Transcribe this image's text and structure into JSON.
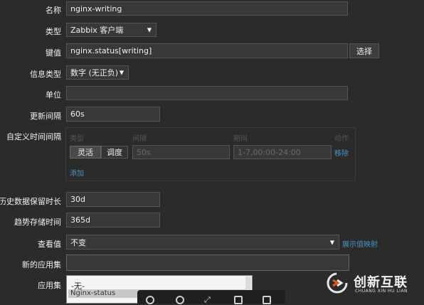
{
  "form": {
    "name_label": "名称",
    "name_value": "nginx-writing",
    "type_label": "类型",
    "type_value": "Zabbix 客户端",
    "key_label": "键值",
    "key_value": "nginx.status[writing]",
    "key_select_button": "选择",
    "info_type_label": "信息类型",
    "info_type_value": "数字 (无正负)",
    "unit_label": "单位",
    "unit_value": "",
    "update_interval_label": "更新间隔",
    "update_interval_value": "60s",
    "custom_intervals_label": "自定义时间间隔",
    "history_label": "历史数据保留时长",
    "history_value": "30d",
    "trends_label": "趋势存储时间",
    "trends_value": "365d",
    "show_value_label": "查看值",
    "show_value_value": "不变",
    "show_value_mapping_link": "展示值映射",
    "new_app_label": "新的应用集",
    "new_app_value": "",
    "apps_label": "应用集"
  },
  "custom_intervals": {
    "headers": [
      "类型",
      "间隔",
      "期间",
      "动作"
    ],
    "seg_flexible": "灵活",
    "seg_scheduling": "调度",
    "interval_placeholder": "50s",
    "period_placeholder": "1-7,00:00-24:00",
    "remove_link": "移除",
    "add_link": "添加"
  },
  "applications": {
    "items": [
      "-无-",
      "Nginx-status"
    ],
    "selected": "Nginx-status"
  },
  "watermark": {
    "brand_cn": "创新互联",
    "brand_en": "CHUANG XIN HU LIAN"
  },
  "colors": {
    "background": "#2b2b2b",
    "field_bg": "#383838",
    "link": "#4796c4",
    "selected_row": "#c8c8c8"
  }
}
